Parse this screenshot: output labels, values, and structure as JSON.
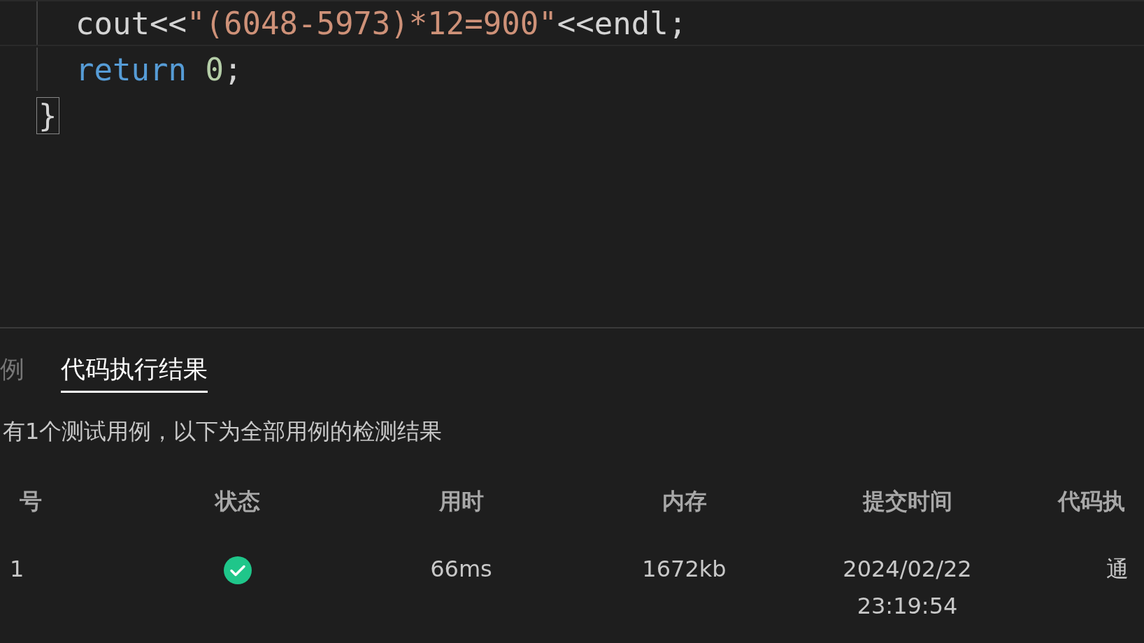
{
  "editor": {
    "block": {
      "children": [
        {
          "current": true,
          "tokens": [
            {
              "kind": "plain",
              "text": "cout<<"
            },
            {
              "kind": "string",
              "text": "\"(6048-5973)*12=900\""
            },
            {
              "kind": "plain",
              "text": "<<endl;"
            }
          ]
        },
        {
          "current": false,
          "tokens": [
            {
              "kind": "keyword",
              "text": "return "
            },
            {
              "kind": "number",
              "text": "0"
            },
            {
              "kind": "plain",
              "text": ";"
            }
          ]
        }
      ]
    },
    "closing": {
      "bracket_match": true,
      "text": "}"
    }
  },
  "tabs": [
    {
      "label": "例",
      "selected": false
    },
    {
      "label": "代码执行结果",
      "selected": true
    }
  ],
  "summary": "有1个测试用例，以下为全部用例的检测结果",
  "table": {
    "columns": [
      "号",
      "状态",
      "用时",
      "内存",
      "提交时间",
      "代码执"
    ],
    "rows": [
      {
        "cells": [
          "1",
          {
            "kind": "passed"
          },
          "66ms",
          "1672kb",
          "2024/02/22\n23:19:54",
          "通"
        ]
      }
    ]
  }
}
